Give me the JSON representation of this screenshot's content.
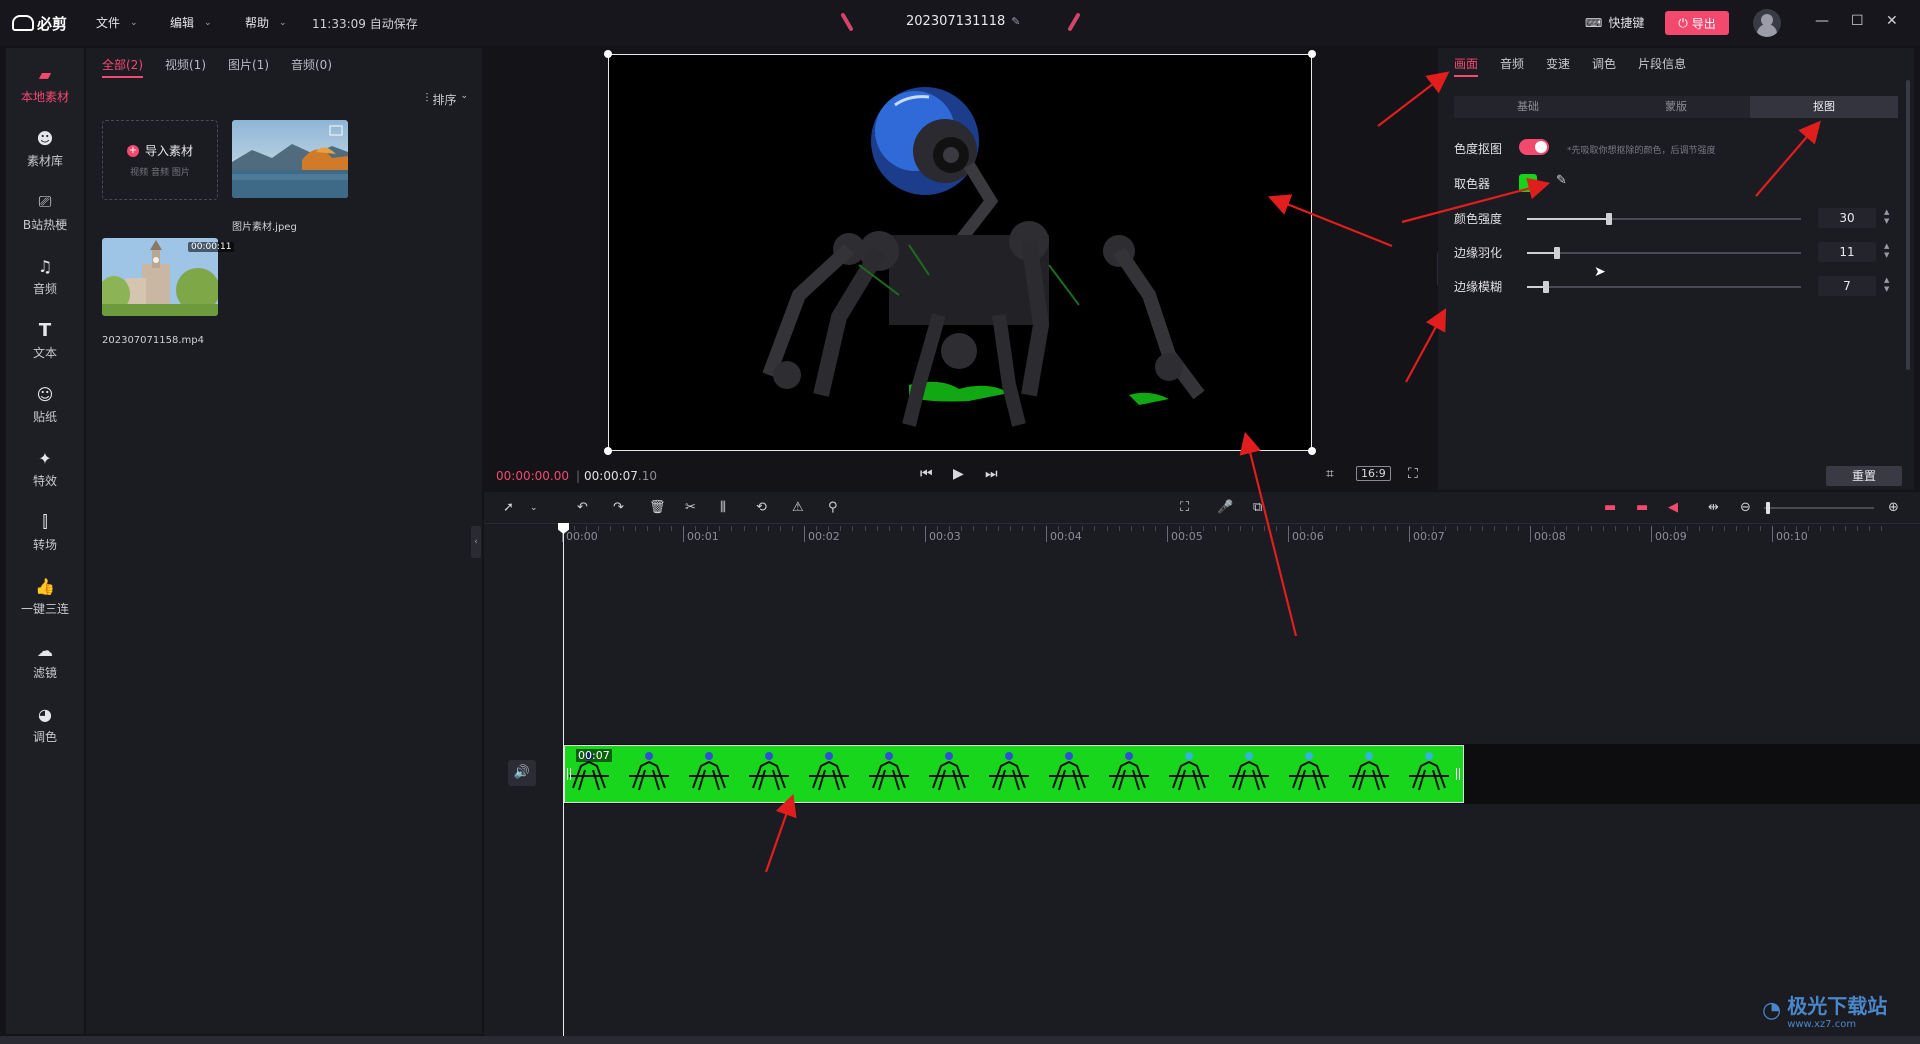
{
  "titlebar": {
    "app_name": "必剪",
    "menus": [
      "文件",
      "编辑",
      "帮助"
    ],
    "autosave": "11:33:09 自动保存",
    "project_name": "202307131118",
    "shortcut_label": "快捷键",
    "export_label": "导出",
    "window_controls": [
      "minimize-icon",
      "maximize-icon",
      "close-icon"
    ]
  },
  "leftnav": {
    "items": [
      {
        "label": "本地素材",
        "icon": "folder-icon",
        "active": true
      },
      {
        "label": "素材库",
        "icon": "library-icon"
      },
      {
        "label": "B站热梗",
        "icon": "tv-icon"
      },
      {
        "label": "音频",
        "icon": "music-icon"
      },
      {
        "label": "文本",
        "icon": "text-icon"
      },
      {
        "label": "贴纸",
        "icon": "sticker-icon"
      },
      {
        "label": "特效",
        "icon": "effects-icon"
      },
      {
        "label": "转场",
        "icon": "transition-icon"
      },
      {
        "label": "一键三连",
        "icon": "thumbs-up-icon"
      },
      {
        "label": "滤镜",
        "icon": "filter-icon"
      },
      {
        "label": "调色",
        "icon": "palette-icon"
      }
    ]
  },
  "media": {
    "tabs": [
      "全部(2)",
      "视频(1)",
      "图片(1)",
      "音频(0)"
    ],
    "active_tab": 0,
    "sort_label": "排序",
    "import_label": "导入素材",
    "import_sub": "视频  音频  图片",
    "files": [
      {
        "name": "图片素材.jpeg",
        "kind": "image"
      },
      {
        "name": "202307071158.mp4",
        "kind": "video",
        "duration": "00:00:11"
      }
    ]
  },
  "preview": {
    "current_time": "00:00:00.00",
    "total_time": "00:00:07",
    "total_time_frac": ".10",
    "aspect_ratio": "16:9"
  },
  "props": {
    "tabs": [
      "画面",
      "音频",
      "变速",
      "调色",
      "片段信息"
    ],
    "active_tab": 0,
    "subtabs": [
      "基础",
      "蒙版",
      "抠图"
    ],
    "active_subtab": 2,
    "chroma_label": "色度抠图",
    "chroma_enabled": true,
    "chroma_hint": "*先吸取你想抠除的颜色，后调节强度",
    "picker_label": "取色器",
    "picked_color": "#14d51a",
    "sliders": [
      {
        "label": "颜色强度",
        "value": "30",
        "fraction": 0.3
      },
      {
        "label": "边缘羽化",
        "value": "11",
        "fraction": 0.11
      },
      {
        "label": "边缘模糊",
        "value": "7",
        "fraction": 0.07
      }
    ],
    "reset_label": "重置"
  },
  "timeline": {
    "ruler": [
      "00:00",
      "00:01",
      "00:02",
      "00:03",
      "00:04",
      "00:05",
      "00:06",
      "00:07",
      "00:08",
      "00:09",
      "00:10"
    ],
    "clip_label": "00:07"
  },
  "watermark": {
    "big": "极光下载站",
    "small": "www.xz7.com"
  },
  "colors": {
    "accent": "#f4496f",
    "annotation_arrow": "#e01e1e",
    "greenscreen": "#18d61c"
  }
}
